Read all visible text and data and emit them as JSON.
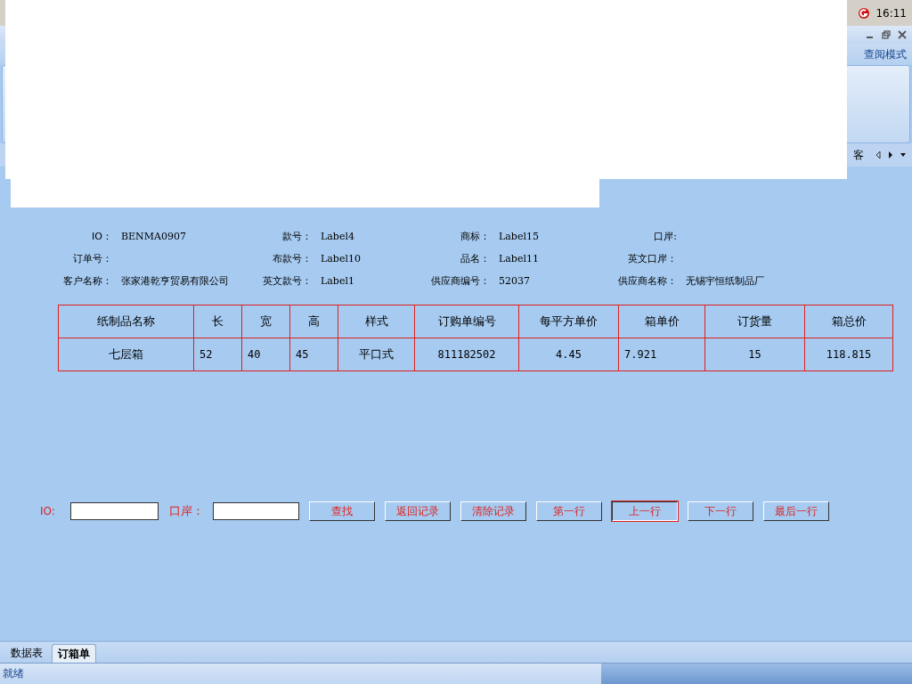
{
  "taskbar": {
    "clock": "16:11"
  },
  "ribbon": {
    "mode_label": "查阅模式",
    "tab_fragment": "客"
  },
  "info": [
    {
      "label": "IO：",
      "value": "BENMA0907"
    },
    {
      "label": "款号：",
      "value": "Label4"
    },
    {
      "label": "商标：",
      "value": "Label15"
    },
    {
      "label": "口岸:"
    },
    {
      "label": "订单号："
    },
    {
      "label": "布款号：",
      "value": "Label10"
    },
    {
      "label": "品名：",
      "value": "Label11"
    },
    {
      "label": "英文口岸："
    },
    {
      "label": "客户名称：",
      "value": "张家港乾亨贸易有限公司"
    },
    {
      "label": "英文款号：",
      "value": "Label1"
    },
    {
      "label": "供应商编号：",
      "value": "52037"
    },
    {
      "label": "供应商名称：",
      "value": "无锡宇恒纸制品厂"
    }
  ],
  "table": {
    "columns": [
      "纸制品名称",
      "长",
      "宽",
      "高",
      "样式",
      "订购单编号",
      "每平方单价",
      "箱单价",
      "订货量",
      "箱总价"
    ],
    "rows": [
      [
        "七层箱",
        "52",
        "40",
        "45",
        "平口式",
        "811182502",
        "4.45",
        "7.921",
        "15",
        "118.815"
      ]
    ]
  },
  "search": [
    {
      "label": "IO:"
    },
    {
      "label": "口岸："
    }
  ],
  "buttons": [
    {
      "label": "查找",
      "focused": false
    },
    {
      "label": "返回记录",
      "focused": false
    },
    {
      "label": "清除记录",
      "focused": false
    },
    {
      "label": "第一行",
      "focused": false
    },
    {
      "label": "上一行",
      "focused": true
    },
    {
      "label": "下一行",
      "focused": false
    },
    {
      "label": "最后一行",
      "focused": false
    }
  ],
  "sheet_tabs": [
    {
      "label": "数据表",
      "selected": false
    },
    {
      "label": "订箱单",
      "selected": true
    }
  ],
  "status_bar": {
    "text": "就绪"
  }
}
